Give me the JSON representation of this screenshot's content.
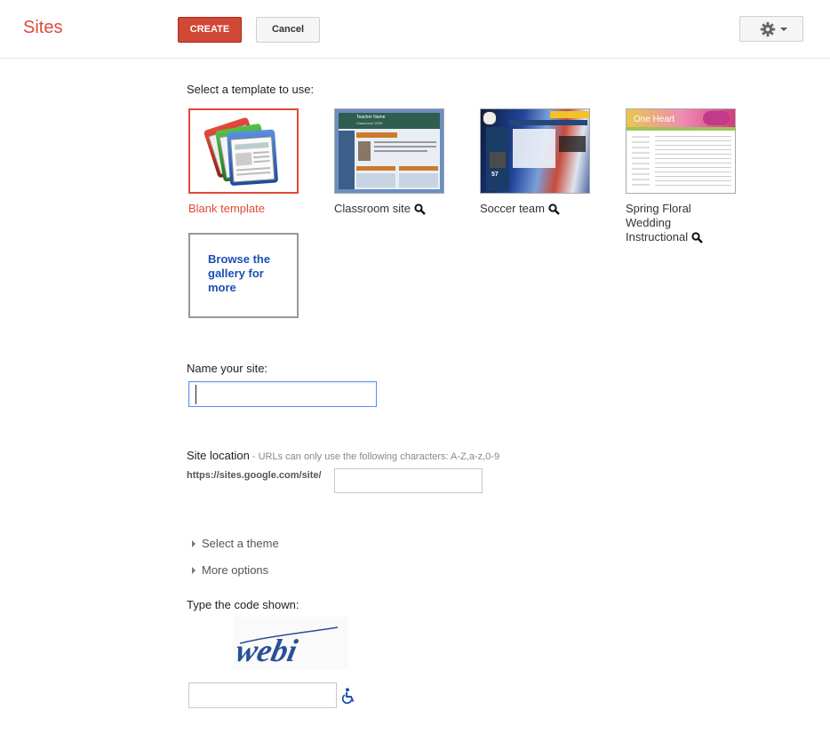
{
  "header": {
    "app_title": "Sites",
    "create_label": "CREATE",
    "cancel_label": "Cancel",
    "settings_icon": "gear-icon"
  },
  "templates": {
    "heading": "Select a template to use:",
    "items": [
      {
        "name": "Blank template",
        "selected": true
      },
      {
        "name": "Classroom site",
        "preview_icon": "magnifier-icon"
      },
      {
        "name": "Soccer team",
        "preview_icon": "magnifier-icon"
      },
      {
        "name": "Spring Floral Wedding Instructional",
        "preview_icon": "magnifier-icon"
      }
    ],
    "classroom_thumb_title": "Teacher Name",
    "classroom_thumb_subtitle": "Classroom 2009",
    "soccer_thumb_score": "57",
    "floral_thumb_banner": "One Heart",
    "browse_label": "Browse the gallery for more"
  },
  "site_name": {
    "label": "Name your site:",
    "value": ""
  },
  "site_location": {
    "label": "Site location",
    "separator": " - ",
    "hint": "URLs can only use the following characters: A-Z,a-z,0-9",
    "url_prefix": "https://sites.google.com/site/",
    "value": ""
  },
  "options": {
    "select_theme": "Select a theme",
    "more_options": "More options"
  },
  "captcha": {
    "label": "Type the code shown:",
    "code_image_text": "webi",
    "value": "",
    "accessibility_icon": "wheelchair-icon"
  },
  "colors": {
    "accent": "#dd4b39",
    "link": "#1c4fb3",
    "focus": "#4d90fe"
  }
}
